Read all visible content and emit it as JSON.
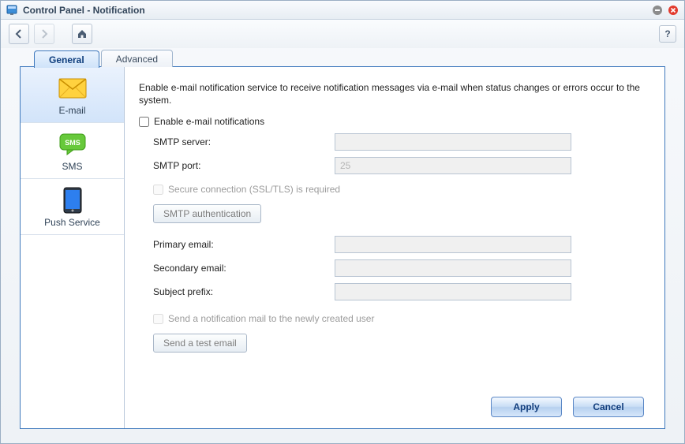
{
  "window": {
    "title": "Control Panel - Notification"
  },
  "tabs": {
    "general": "General",
    "advanced": "Advanced"
  },
  "sidebar": {
    "email": "E-mail",
    "sms": "SMS",
    "push": "Push Service"
  },
  "form": {
    "intro": "Enable e-mail notification service to receive notification messages via e-mail when status changes or errors occur to the system.",
    "enable_label": "Enable e-mail notifications",
    "smtp_server_label": "SMTP server:",
    "smtp_server_value": "",
    "smtp_port_label": "SMTP port:",
    "smtp_port_placeholder": "25",
    "secure_label": "Secure connection (SSL/TLS) is required",
    "smtp_auth_btn": "SMTP authentication",
    "primary_email_label": "Primary email:",
    "secondary_email_label": "Secondary email:",
    "subject_prefix_label": "Subject prefix:",
    "send_new_user_label": "Send a notification mail to the newly created user",
    "send_test_btn": "Send a test email"
  },
  "buttons": {
    "apply": "Apply",
    "cancel": "Cancel",
    "help": "?"
  }
}
